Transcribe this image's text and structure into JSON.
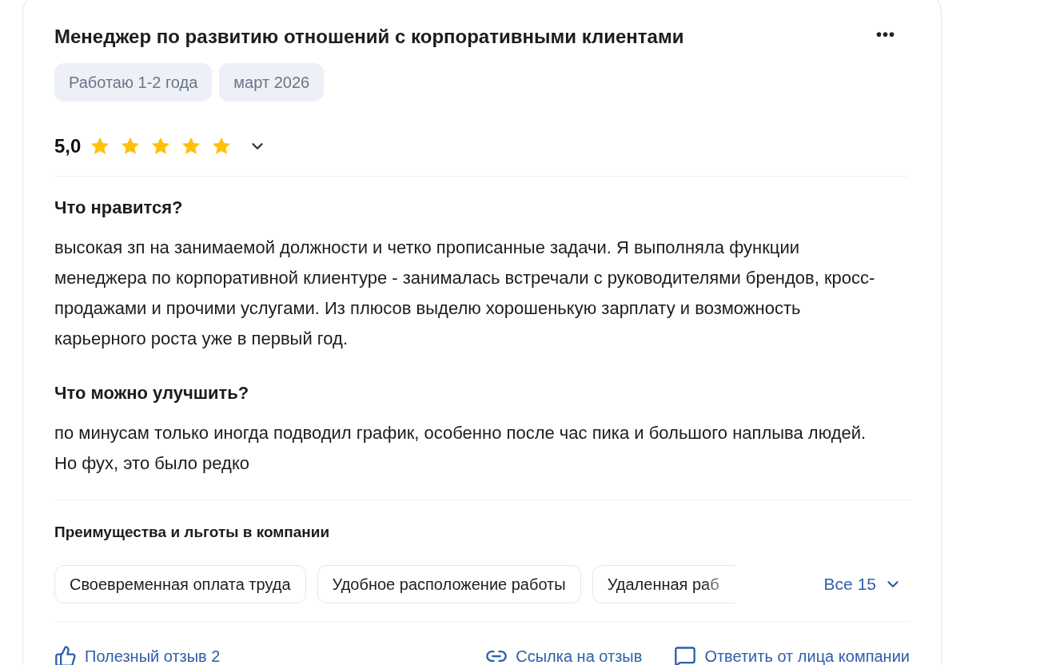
{
  "review": {
    "title": "Менеджер по развитию отношений с корпоративными клиентами",
    "menu_icon": "•••",
    "tags": [
      "Работаю 1-2 года",
      "март 2026"
    ],
    "rating": {
      "value": "5,0",
      "stars": 5
    },
    "sections": [
      {
        "heading": "Что нравится?",
        "text": "высокая зп на занимаемой должности и четко прописанные задачи. Я выполняла функции менеджера по корпоративной клиентуре - занималась встречали с руководителями брендов, кросс-продажами и прочими услугами. Из плюсов выделю хорошенькую зарплату и возможность карьерного роста уже в первый год."
      },
      {
        "heading": "Что можно улучшить?",
        "text": "по минусам только иногда подводил график, особенно после час пика и большого наплыва людей. Но фух, это было редко"
      }
    ],
    "benefits": {
      "heading": "Преимущества и льготы в компании",
      "chips": [
        "Своевременная оплата труда",
        "Удобное расположение работы",
        "Удаленная раб"
      ],
      "more": "Все 15"
    },
    "actions": [
      {
        "kind": "like",
        "label": "Полезный отзыв 2"
      },
      {
        "kind": "link",
        "label": "Ссылка на отзыв"
      },
      {
        "kind": "reply",
        "label": "Ответить от лица компании"
      }
    ]
  }
}
